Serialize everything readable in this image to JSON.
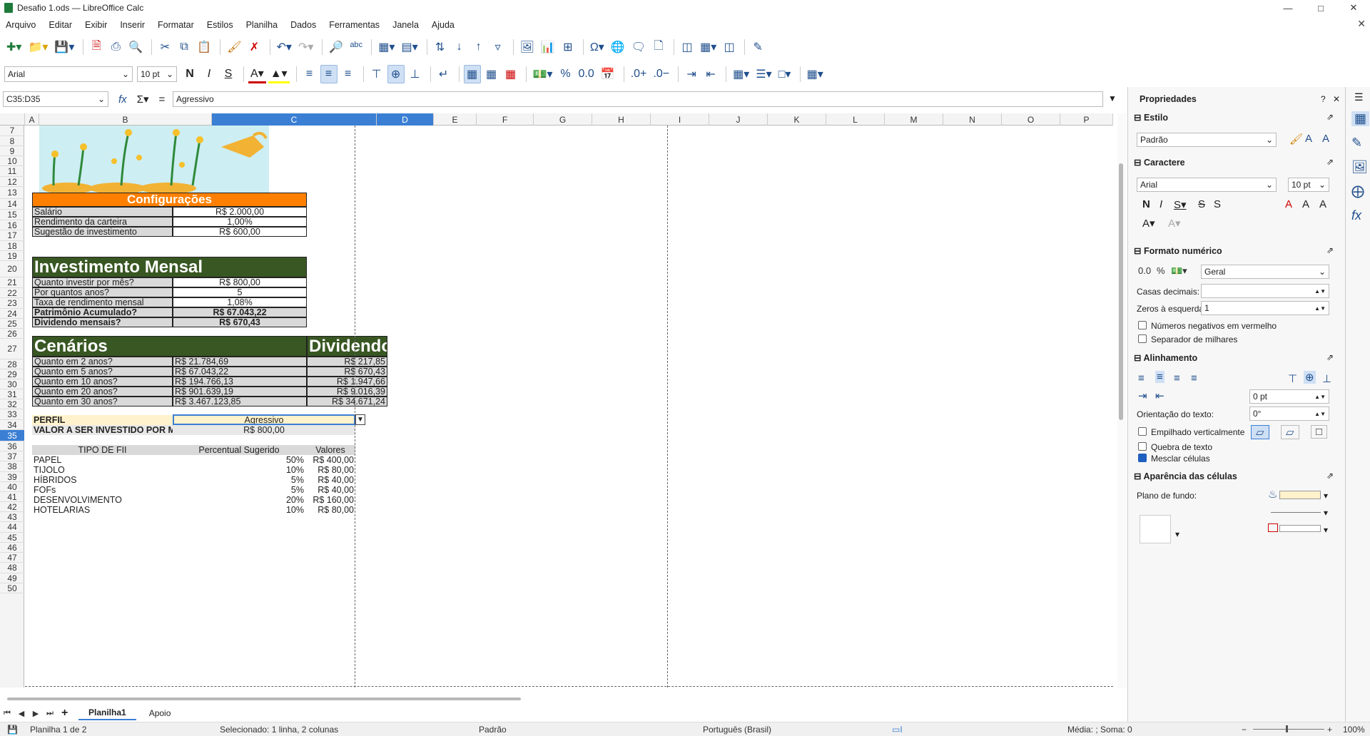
{
  "window": {
    "title": "Desafio 1.ods — LibreOffice Calc"
  },
  "menu": [
    "Arquivo",
    "Editar",
    "Exibir",
    "Inserir",
    "Formatar",
    "Estilos",
    "Planilha",
    "Dados",
    "Ferramentas",
    "Janela",
    "Ajuda"
  ],
  "toolbar": {
    "font_name": "Arial",
    "font_size": "10 pt",
    "bold": "N",
    "italic": "I",
    "underline": "S"
  },
  "formula_bar": {
    "name_box": "C35:D35",
    "content": "Agressivo"
  },
  "columns": [
    "A",
    "B",
    "C",
    "D",
    "E",
    "F",
    "G",
    "H",
    "I",
    "J",
    "K",
    "L",
    "M",
    "N",
    "O",
    "P"
  ],
  "rows": [
    "7",
    "8",
    "9",
    "10",
    "11",
    "12",
    "13",
    "14",
    "15",
    "16",
    "17",
    "18",
    "19",
    "20",
    "21",
    "22",
    "23",
    "24",
    "25",
    "26",
    "27",
    "28",
    "29",
    "30",
    "31",
    "32",
    "33",
    "34",
    "35",
    "36",
    "37",
    "38",
    "39",
    "40",
    "41",
    "42",
    "43",
    "44",
    "45",
    "46",
    "47",
    "48",
    "49",
    "50"
  ],
  "sheet": {
    "config": {
      "title": "Configurações",
      "rows": [
        {
          "label": "Salário",
          "value": "R$ 2.000,00"
        },
        {
          "label": "Rendimento da carteira",
          "value": "1,00%"
        },
        {
          "label": "Sugestão de investimento",
          "value": "R$ 600,00"
        }
      ]
    },
    "mensal": {
      "title": "Investimento Mensal",
      "rows": [
        {
          "label": "Quanto investir por mês?",
          "value": "R$ 800,00"
        },
        {
          "label": "Por quantos anos?",
          "value": "5"
        },
        {
          "label": "Taxa de rendimento mensal",
          "value": "1,08%"
        },
        {
          "label": "Patrimônio Acumulado?",
          "value": "R$ 67.043,22"
        },
        {
          "label": "Dividendo mensais?",
          "value": "R$ 670,43"
        }
      ]
    },
    "cenarios": {
      "title": "Cenários",
      "title2": "Dividendo",
      "rows": [
        {
          "label": "Quanto em 2 anos?",
          "value": "R$ 21.784,69",
          "div": "R$ 217,85"
        },
        {
          "label": "Quanto em 5 anos?",
          "value": "R$ 67.043,22",
          "div": "R$ 670,43"
        },
        {
          "label": "Quanto em 10 anos?",
          "value": "R$ 194.766,13",
          "div": "R$ 1.947,66"
        },
        {
          "label": "Quanto em 20 anos?",
          "value": "R$ 901.639,19",
          "div": "R$ 9.016,39"
        },
        {
          "label": "Quanto em 30 anos?",
          "value": "R$ 3.467.123,85",
          "div": "R$ 34.671,24"
        }
      ]
    },
    "perfil": {
      "label": "PERFIL",
      "value": "Agressivo",
      "valor_label": "VALOR A SER INVESTIDO POR MÊS",
      "valor": "R$ 800,00"
    },
    "fii": {
      "headers": [
        "TIPO DE FII",
        "Percentual Sugerido",
        "Valores"
      ],
      "rows": [
        {
          "tipo": "PAPEL",
          "pct": "50%",
          "val": "R$ 400,00"
        },
        {
          "tipo": "TIJOLO",
          "pct": "10%",
          "val": "R$ 80,00"
        },
        {
          "tipo": "HÍBRIDOS",
          "pct": "5%",
          "val": "R$ 40,00"
        },
        {
          "tipo": "FOFs",
          "pct": "5%",
          "val": "R$ 40,00"
        },
        {
          "tipo": "DESENVOLVIMENTO",
          "pct": "20%",
          "val": "R$ 160,00"
        },
        {
          "tipo": "HOTELARIAS",
          "pct": "10%",
          "val": "R$ 80,00"
        }
      ]
    }
  },
  "tabs": [
    "Planilha1",
    "Apoio"
  ],
  "status": {
    "sheet": "Planilha 1 de 2",
    "selection": "Selecionado: 1 linha, 2 colunas",
    "style": "Padrão",
    "lang": "Português (Brasil)",
    "sum": "Média: ; Soma: 0",
    "zoom": "100%"
  },
  "sidebar": {
    "title": "Propriedades",
    "style_section": "Estilo",
    "style_value": "Padrão",
    "char_section": "Caractere",
    "font": "Arial",
    "size": "10 pt",
    "num_section": "Formato numérico",
    "num_format": "Geral",
    "casas": "Casas decimais:",
    "zeros": "Zeros à esquerda:",
    "zeros_val": "1",
    "neg_red": "Números negativos em vermelho",
    "thousand": "Separador de milhares",
    "align_section": "Alinhamento",
    "indent_val": "0 pt",
    "orient_label": "Orientação do texto:",
    "orient_val": "0°",
    "stacked": "Empilhado verticalmente",
    "wrap": "Quebra de texto",
    "merge": "Mesclar células",
    "appear_section": "Aparência das células",
    "bg_label": "Plano de fundo:"
  },
  "colors": {
    "orange": "#ff8000",
    "dark_green": "#385723",
    "selection": "#3b7fd4",
    "perfil_bg": "#fff2cc"
  }
}
